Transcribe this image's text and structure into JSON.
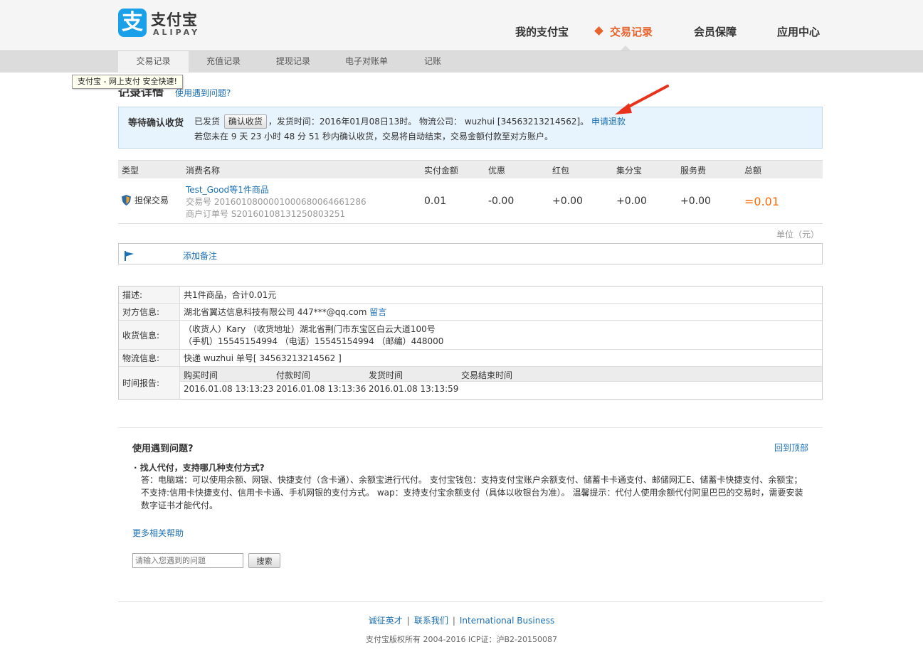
{
  "logo": {
    "cn": "支付宝",
    "en": "ALIPAY",
    "glyph": "支"
  },
  "topnav": [
    {
      "label": "我的支付宝"
    },
    {
      "label": "交易记录"
    },
    {
      "label": "会员保障"
    },
    {
      "label": "应用中心"
    }
  ],
  "subnav": [
    {
      "label": "交易记录"
    },
    {
      "label": "充值记录"
    },
    {
      "label": "提现记录"
    },
    {
      "label": "电子对账单"
    },
    {
      "label": "记账"
    }
  ],
  "tooltip": "支付宝 - 网上支付 安全快速!",
  "page": {
    "title": "记录详情",
    "help_link": "使用遇到问题?"
  },
  "notice": {
    "status": "等待确认收货",
    "shipped": "已发货",
    "confirm_button": "确认收货",
    "ship_info": "，发货时间：2016年01月08日13时。 物流公司： wuzhui [34563213214562]。",
    "refund_link": "申请退款",
    "auto_text": "若您未在 9 天 23 小时 48 分 51 秒内确认收货，交易将自动结束，交易金额付款至对方账户。"
  },
  "trade_table": {
    "headers": [
      "类型",
      "消费名称",
      "实付金额",
      "优惠",
      "红包",
      "集分宝",
      "服务费",
      "总额"
    ],
    "row": {
      "type": "担保交易",
      "goods": "Test_Good等1件商品",
      "trade_no": "交易号 2016010800001000680064661286",
      "order_no": "商户订单号 S20160108131250803251",
      "paid": "0.01",
      "discount": "-0.00",
      "red_packet": "+0.00",
      "jifenbao": "+0.00",
      "service_fee": "+0.00",
      "total": "=0.01"
    },
    "unit": "单位（元）"
  },
  "note": {
    "link": "添加备注"
  },
  "details": {
    "desc_label": "描述:",
    "desc_value": "共1件商品，合计0.01元",
    "party_label": "对方信息:",
    "party_value": "湖北省翼达信息科技有限公司 447***@qq.com",
    "party_link": "留言",
    "receive_label": "收货信息:",
    "receive_line1": "（收货人）Kary （收货地址）湖北省荆门市东宝区白云大道100号",
    "receive_line2": "（手机）15545154994 （电话）15545154994 （邮编）448000",
    "logistics_label": "物流信息:",
    "logistics_value": "快递 wuzhui 单号[ 34563213214562 ]",
    "time_label": "时间报告:",
    "time_headers": [
      "购买时间",
      "付款时间",
      "发货时间",
      "交易结束时间"
    ],
    "time_values": [
      "2016.01.08 13:13:23",
      "2016.01.08 13:13:36",
      "2016.01.08 13:13:59",
      ""
    ]
  },
  "help": {
    "title": "使用遇到问题?",
    "to_top": "回到顶部",
    "question": "找人代付，支持哪几种支付方式?",
    "answer": "答：电脑端：可以使用余额、网银、快捷支付（含卡通）、余额宝进行代付。 支付宝钱包：支持支付宝账户余额支付、储蓄卡卡通支付、邮储网汇E、储蓄卡快捷支付、余额宝；不支持:信用卡快捷支付、信用卡卡通、手机网银的支付方式。 wap：支持支付宝余额支付（具体以收银台为准）。 温馨提示：代付人使用余额代付阿里巴巴的交易时，需要安装数字证书才能代付。",
    "more": "更多相关帮助",
    "search_placeholder": "请输入您遇到的问题",
    "search_button": "搜索"
  },
  "footer": {
    "links": [
      "诚征英才",
      "联系我们",
      "International Business"
    ],
    "copyright": "支付宝版权所有 2004-2016 ICP证：沪B2-20150087"
  },
  "colors": {
    "accent": "#e8642c",
    "link": "#1a6fb5",
    "total": "#ff6600",
    "notice_bg": "#e8f4fd"
  }
}
